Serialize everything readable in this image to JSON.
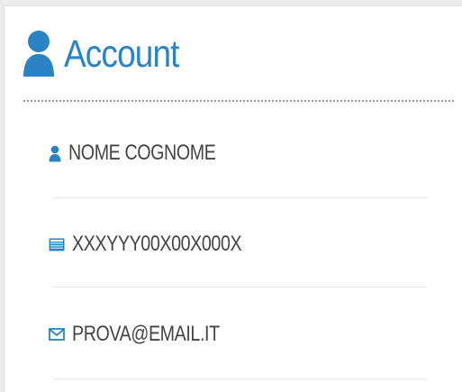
{
  "account": {
    "title": "Account",
    "title_icon": "user-icon",
    "accent_color": "#2a83c2",
    "fields": [
      {
        "icon": "user-icon",
        "value": "NOME COGNOME"
      },
      {
        "icon": "id-card-icon",
        "value": "XXXYYY00X00X000X"
      },
      {
        "icon": "envelope-icon",
        "value": "PROVA@EMAIL.IT"
      }
    ]
  }
}
